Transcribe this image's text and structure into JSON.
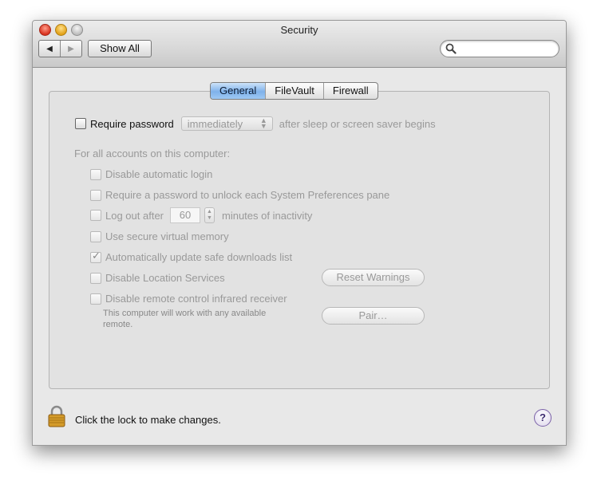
{
  "window": {
    "title": "Security"
  },
  "toolbar": {
    "back_icon": "triangle-left-icon",
    "forward_icon": "triangle-right-icon",
    "show_all_label": "Show All",
    "search_placeholder": "",
    "search_value": ""
  },
  "tabs": [
    {
      "label": "General",
      "active": true
    },
    {
      "label": "FileVault",
      "active": false
    },
    {
      "label": "Firewall",
      "active": false
    }
  ],
  "general": {
    "require_password": {
      "label": "Require password",
      "checked": false,
      "popup_value": "immediately",
      "suffix": "after sleep or screen saver begins"
    },
    "accounts_heading": "For all accounts on this computer:",
    "options": [
      {
        "label": "Disable automatic login",
        "checked": false
      },
      {
        "label": "Require a password to unlock each System Preferences pane",
        "checked": false
      },
      {
        "label": "Log out after",
        "checked": false,
        "value": "60",
        "suffix": "minutes of inactivity"
      },
      {
        "label": "Use secure virtual memory",
        "checked": false
      },
      {
        "label": "Automatically update safe downloads list",
        "checked": true
      },
      {
        "label": "Disable Location Services",
        "checked": false
      },
      {
        "label": "Disable remote control infrared receiver",
        "checked": false
      }
    ],
    "reset_warnings_label": "Reset Warnings",
    "pair_label": "Pair…",
    "remote_note_line1": "This computer will work with any available",
    "remote_note_line2": "remote."
  },
  "footer": {
    "lock_text": "Click the lock to make changes.",
    "help_label": "?"
  },
  "colors": {
    "active_tab": "#7fb2ea",
    "disabled_text": "#999999",
    "close_button": "#d8321f",
    "minimize_button": "#e2a118",
    "lock_gold": "#d49b2a"
  }
}
